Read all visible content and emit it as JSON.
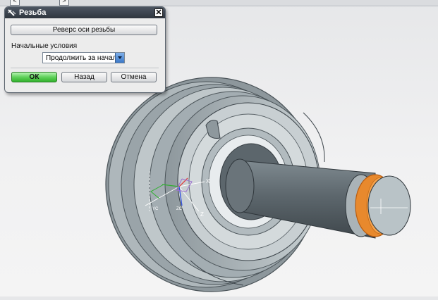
{
  "dialog": {
    "title": "Резьба",
    "reverse_button": "Реверс оси резьбы",
    "initial_conditions_label": "Начальные условия",
    "initial_conditions_value": "Продолжить за начало",
    "ok_label": "ОК",
    "back_label": "Назад",
    "cancel_label": "Отмена",
    "close_glyph": "✕"
  },
  "nav": {
    "left_glyph": "<",
    "right_glyph": ">"
  },
  "triad": {
    "x_label": "X",
    "y_label": "Y",
    "z_label": "Z",
    "yc_label": "YC",
    "zc_label": "ZC"
  },
  "colors": {
    "model": "#b9c3c7",
    "highlight": "#e8892d",
    "ok_button": "#4cc447",
    "title_bar": "#3a424c"
  }
}
